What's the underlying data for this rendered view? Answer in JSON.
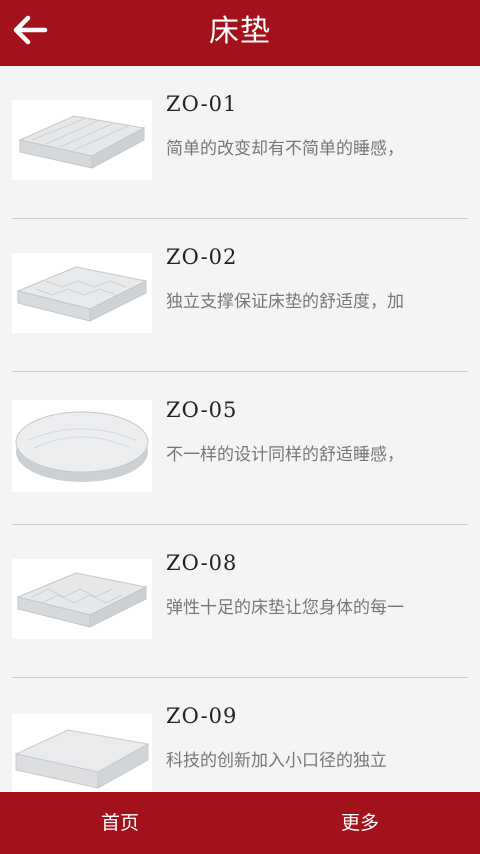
{
  "header": {
    "title": "床垫",
    "back_icon": "arrow-left-icon"
  },
  "colors": {
    "brand": "#a3121a",
    "background": "#f4f4f4",
    "title_text": "#222222",
    "desc_text": "#777777",
    "separator": "#c9c9c9"
  },
  "products": [
    {
      "code": "ZO-01",
      "desc": "简单的改变却有不简单的睡感，",
      "image": "mattress-rect-image"
    },
    {
      "code": "ZO-02",
      "desc": "独立支撑保证床垫的舒适度，加",
      "image": "mattress-rect-image"
    },
    {
      "code": "ZO-05",
      "desc": "不一样的设计同样的舒适睡感，",
      "image": "mattress-round-image"
    },
    {
      "code": "ZO-08",
      "desc": "弹性十足的床垫让您身体的每一",
      "image": "mattress-rect-image"
    },
    {
      "code": "ZO-09",
      "desc": "科技的创新加入小口径的独立",
      "image": "mattress-rect-image"
    }
  ],
  "footer": {
    "home_label": "首页",
    "more_label": "更多"
  }
}
